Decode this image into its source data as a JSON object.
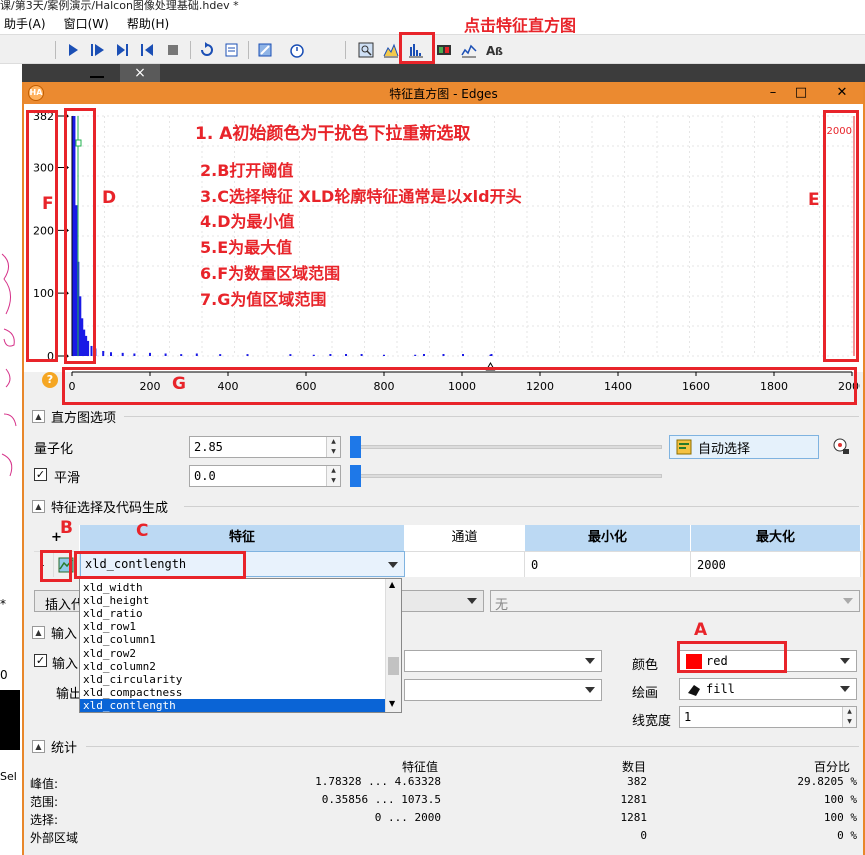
{
  "background": {
    "title_fragment": "课/第3天/案例演示/Halcon图像处理基础.hdev *",
    "menu": [
      "助手(A)",
      "窗口(W)",
      "帮助(H)"
    ],
    "fragments": {
      "star": "*",
      "zero": "0",
      "sel": "Sel"
    }
  },
  "dialog": {
    "title": "特征直方图 - Edges",
    "app_icon_text": "HA",
    "win_min": "–",
    "win_max": "□",
    "win_close": "✕",
    "help_glyph": "?"
  },
  "histogram": {
    "y_ticks": [
      "382",
      "300",
      "200",
      "100",
      "0"
    ],
    "x_ticks": [
      "0",
      "200",
      "400",
      "600",
      "800",
      "1000",
      "1200",
      "1400",
      "1600",
      "1800",
      "2000"
    ],
    "max_marker": "2000",
    "bar_color": "#1a1ae6"
  },
  "chart_data": {
    "type": "bar",
    "xlim": [
      0,
      2000
    ],
    "ylim": [
      0,
      382
    ],
    "x": [
      5,
      10,
      15,
      20,
      25,
      30,
      35,
      40,
      50,
      60,
      80,
      100,
      130,
      160,
      200,
      240,
      280,
      320,
      380,
      450,
      560,
      620,
      800,
      880,
      1073
    ],
    "values": [
      382,
      240,
      150,
      95,
      60,
      42,
      32,
      24,
      16,
      12,
      8,
      6,
      5,
      4,
      5,
      4,
      3,
      4,
      3,
      3,
      3,
      2,
      2,
      2,
      2
    ],
    "min_value": 0,
    "max_value": 2000
  },
  "histogram_options": {
    "section_title": "直方图选项",
    "quantize_label": "量子化",
    "quantize_value": "2.85",
    "smooth_label": "平滑",
    "smooth_value": "0.0",
    "smooth_checked": "✓",
    "auto_select_label": "自动选择"
  },
  "feature_section": {
    "title": "特征选择及代码生成",
    "add": "+",
    "remove": "-",
    "columns": [
      "特征",
      "通道",
      "最小化",
      "最大化"
    ],
    "row": {
      "feature": "xld_contlength",
      "channel": "",
      "min": "0",
      "max": "2000"
    },
    "dropdown_items": [
      "xld_width",
      "xld_height",
      "xld_ratio",
      "xld_row1",
      "xld_column1",
      "xld_row2",
      "xld_column2",
      "xld_circularity",
      "xld_compactness",
      "xld_contlength"
    ],
    "selected_index": 9,
    "insert_label": "插入代",
    "none_label": "无"
  },
  "input_output": {
    "section_title": "输入",
    "input_label": "输入",
    "input_checked": "✓",
    "output_label": "输出",
    "color_label": "颜色",
    "color_value": "red",
    "color_swatch": "#ff0000",
    "draw_label": "绘画",
    "draw_value": "fill",
    "line_width_label": "线宽度",
    "line_width_value": "1"
  },
  "stats": {
    "section_title": "统计",
    "headers": [
      "特征值",
      "数目",
      "百分比"
    ],
    "rows": [
      {
        "label": "峰值:",
        "value": "1.78328 ... 4.63328",
        "count": "382",
        "percent": "29.8205 %"
      },
      {
        "label": "范围:",
        "value": "0.35856 ... 1073.5",
        "count": "1281",
        "percent": "100 %"
      },
      {
        "label": "选择:",
        "value": "0 ... 2000",
        "count": "1281",
        "percent": "100 %"
      },
      {
        "label": "外部区域",
        "value": "",
        "count": "0",
        "percent": "0 %"
      }
    ]
  },
  "annotations": {
    "toolbar_hint": "点击特征直方图",
    "steps": [
      "1. A初始颜色为干扰色下拉重新选取",
      "2.B打开阈值",
      "3.C选择特征 XLD轮廓特征通常是以xld开头",
      "4.D为最小值",
      "5.E为最大值",
      "6.F为数量区域范围",
      "7.G为值区域范围"
    ],
    "letters": {
      "A": "A",
      "B": "B",
      "C": "C",
      "D": "D",
      "E": "E",
      "F": "F",
      "G": "G"
    }
  }
}
